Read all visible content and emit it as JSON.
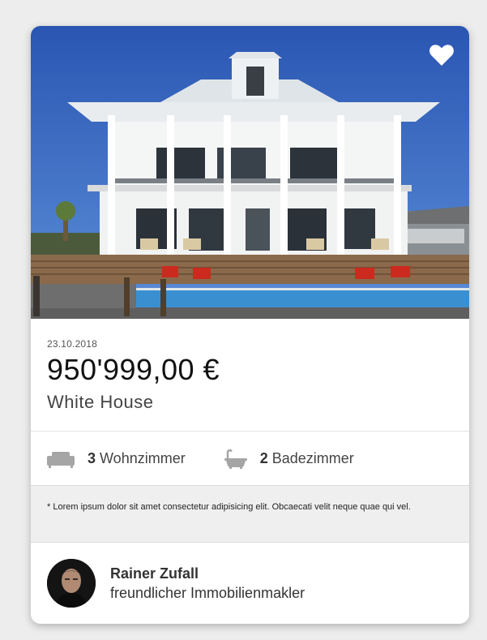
{
  "listing": {
    "date": "23.10.2018",
    "price": "950'999,00 €",
    "title": "White House"
  },
  "features": {
    "living_count": "3",
    "living_label": "Wohnzimmer",
    "bath_count": "2",
    "bath_label": "Badezimmer"
  },
  "note": "* Lorem ipsum dolor sit amet consectetur adipisicing elit. Obcaecati velit neque quae qui vel.",
  "agent": {
    "name": "Rainer Zufall",
    "role": "freundlicher Immobilienmakler"
  },
  "icons": {
    "favorite": "heart-icon",
    "living": "sofa-icon",
    "bath": "bathtub-icon"
  },
  "colors": {
    "background": "#ededed",
    "card": "#ffffff",
    "note_background": "#efefef",
    "sky": "#2f5fb8",
    "pool": "#3a8fd0",
    "chairs": "#cc2a1e"
  }
}
